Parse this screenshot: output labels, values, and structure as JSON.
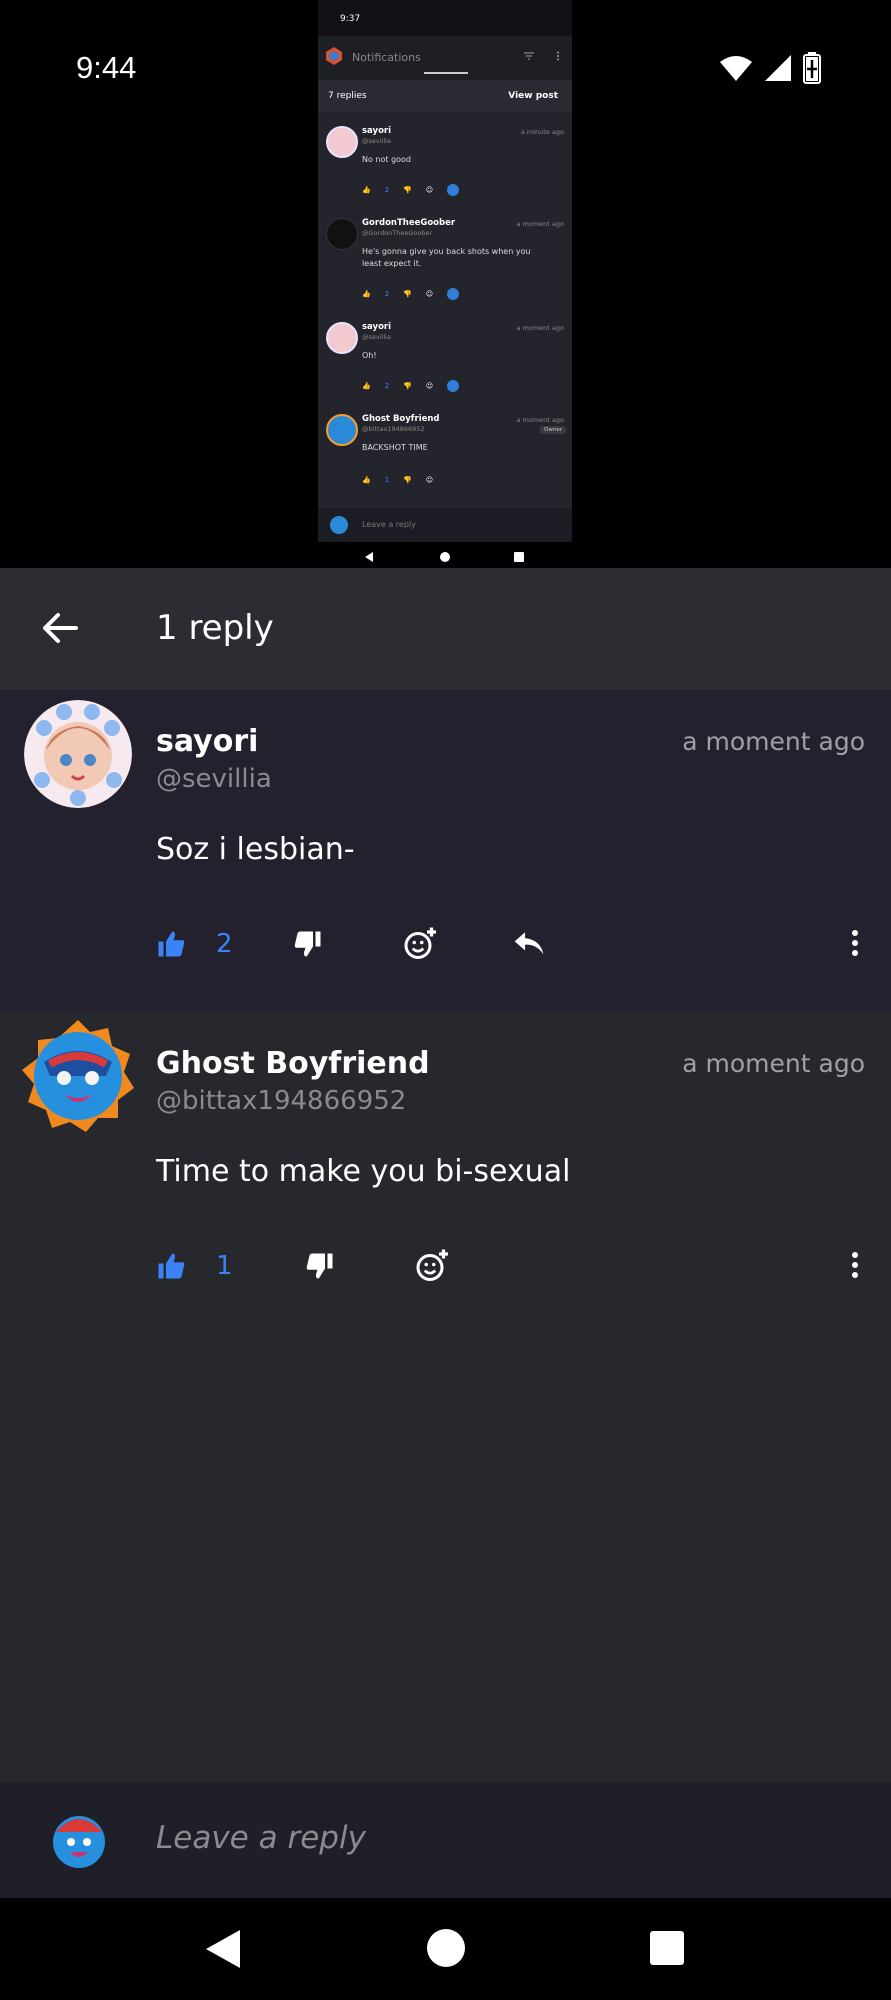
{
  "status_bar": {
    "time": "9:44"
  },
  "embedded_screenshot": {
    "status_time": "9:37",
    "app_title": "Notifications",
    "replies_count": "7 replies",
    "view_post": "View post",
    "comments": [
      {
        "name": "sayori",
        "handle": "@sevillia",
        "when": "a minute ago",
        "text": "No not good",
        "likes": "2",
        "badge": ""
      },
      {
        "name": "GordonTheeGoober",
        "handle": "@GordonTheeGoober",
        "when": "a moment ago",
        "text": "He's gonna give you back shots when you least expect it.",
        "likes": "2",
        "badge": ""
      },
      {
        "name": "sayori",
        "handle": "@sevillia",
        "when": "a moment ago",
        "text": "Oh!",
        "likes": "2",
        "badge": ""
      },
      {
        "name": "Ghost Boyfriend",
        "handle": "@bittax194866952",
        "when": "a moment ago",
        "text": "BACKSHOT TIME",
        "likes": "1",
        "badge": "Owner"
      }
    ],
    "reply_placeholder": "Leave a reply"
  },
  "appbar": {
    "title": "1 reply"
  },
  "comments": [
    {
      "name": "sayori",
      "handle": "@sevillia",
      "when": "a moment ago",
      "text": "Soz i lesbian-",
      "likes": "2"
    },
    {
      "name": "Ghost Boyfriend",
      "handle": "@bittax194866952",
      "when": "a moment ago",
      "text": "Time to make you bi-sexual",
      "likes": "1"
    }
  ],
  "reply_bar": {
    "placeholder": "Leave a reply"
  },
  "colors": {
    "accent": "#3b82f6",
    "background": "#27272e",
    "highlight_comment": "#23212e"
  }
}
